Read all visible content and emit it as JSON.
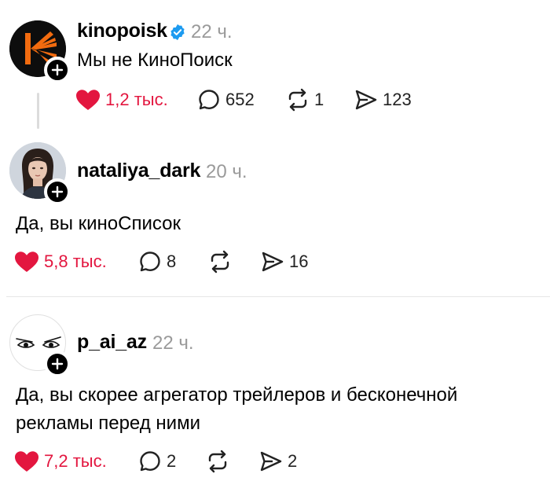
{
  "posts": [
    {
      "username": "kinopoisk",
      "time": "22 ч.",
      "text": "Мы не КиноПоиск",
      "likes": "1,2 тыс.",
      "comments": "652",
      "reposts": "1",
      "shares": "123"
    },
    {
      "username": "nataliya_dark",
      "time": "20 ч.",
      "text": "Да, вы киноСписок",
      "likes": "5,8 тыс.",
      "comments": "8",
      "shares": "16"
    },
    {
      "username": "p_ai_az",
      "time": "22 ч.",
      "text_line1": "Да, вы скорее агрегатор трейлеров и бесконечной",
      "text_line2": "рекламы перед ними",
      "likes": "7,2 тыс.",
      "comments": "2",
      "shares": "2"
    }
  ],
  "colors": {
    "like": "#e3163f",
    "verified": "#1d9bf0",
    "kinopoisk_orange": "#f26b0f"
  },
  "icons": [
    "heart-icon",
    "comment-icon",
    "repost-icon",
    "share-icon",
    "plus-icon",
    "verified-icon"
  ]
}
